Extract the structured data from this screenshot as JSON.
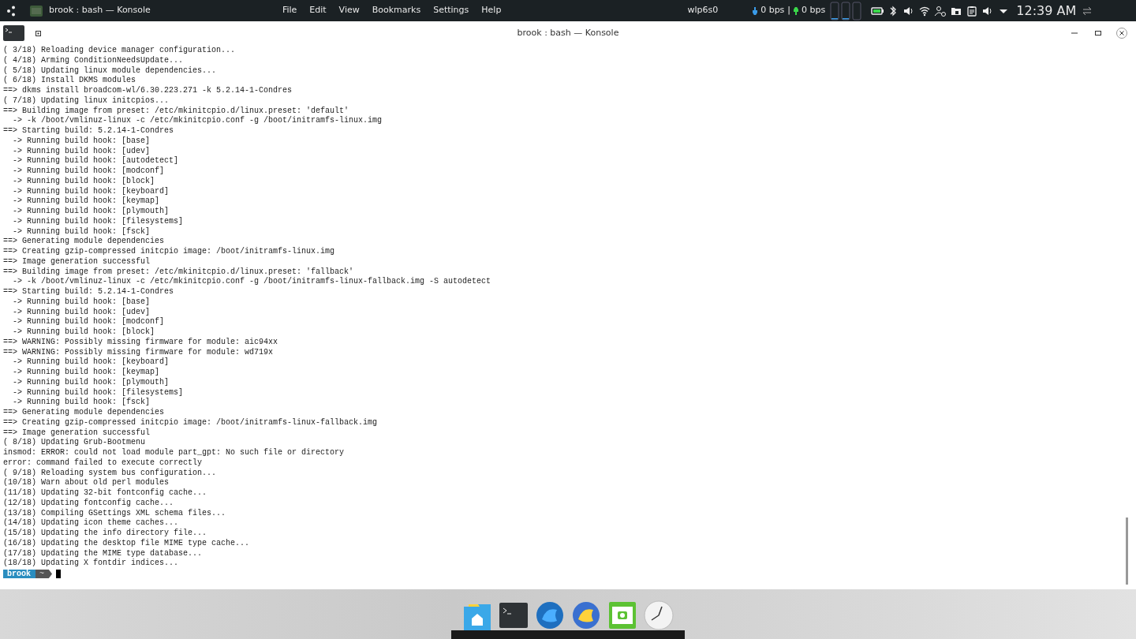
{
  "top_panel": {
    "window_title": "brook : bash — Konsole",
    "menu": [
      "File",
      "Edit",
      "View",
      "Bookmarks",
      "Settings",
      "Help"
    ],
    "network_interface": "wlp6s0",
    "download_rate": "0 bps",
    "separator": "|",
    "upload_rate": "0 bps",
    "clock": "12:39 AM"
  },
  "window": {
    "title": "brook : bash — Konsole"
  },
  "terminal": {
    "lines": [
      "( 3/18) Reloading device manager configuration...",
      "( 4/18) Arming ConditionNeedsUpdate...",
      "( 5/18) Updating linux module dependencies...",
      "( 6/18) Install DKMS modules",
      "==> dkms install broadcom-wl/6.30.223.271 -k 5.2.14-1-Condres",
      "( 7/18) Updating linux initcpios...",
      "==> Building image from preset: /etc/mkinitcpio.d/linux.preset: 'default'",
      "  -> -k /boot/vmlinuz-linux -c /etc/mkinitcpio.conf -g /boot/initramfs-linux.img",
      "==> Starting build: 5.2.14-1-Condres",
      "  -> Running build hook: [base]",
      "  -> Running build hook: [udev]",
      "  -> Running build hook: [autodetect]",
      "  -> Running build hook: [modconf]",
      "  -> Running build hook: [block]",
      "  -> Running build hook: [keyboard]",
      "  -> Running build hook: [keymap]",
      "  -> Running build hook: [plymouth]",
      "  -> Running build hook: [filesystems]",
      "  -> Running build hook: [fsck]",
      "==> Generating module dependencies",
      "==> Creating gzip-compressed initcpio image: /boot/initramfs-linux.img",
      "==> Image generation successful",
      "==> Building image from preset: /etc/mkinitcpio.d/linux.preset: 'fallback'",
      "  -> -k /boot/vmlinuz-linux -c /etc/mkinitcpio.conf -g /boot/initramfs-linux-fallback.img -S autodetect",
      "==> Starting build: 5.2.14-1-Condres",
      "  -> Running build hook: [base]",
      "  -> Running build hook: [udev]",
      "  -> Running build hook: [modconf]",
      "  -> Running build hook: [block]",
      "==> WARNING: Possibly missing firmware for module: aic94xx",
      "==> WARNING: Possibly missing firmware for module: wd719x",
      "  -> Running build hook: [keyboard]",
      "  -> Running build hook: [keymap]",
      "  -> Running build hook: [plymouth]",
      "  -> Running build hook: [filesystems]",
      "  -> Running build hook: [fsck]",
      "==> Generating module dependencies",
      "==> Creating gzip-compressed initcpio image: /boot/initramfs-linux-fallback.img",
      "==> Image generation successful",
      "( 8/18) Updating Grub-Bootmenu",
      "insmod: ERROR: could not load module part_gpt: No such file or directory",
      "error: command failed to execute correctly",
      "( 9/18) Reloading system bus configuration...",
      "(10/18) Warn about old perl modules",
      "(11/18) Updating 32-bit fontconfig cache...",
      "(12/18) Updating fontconfig cache...",
      "(13/18) Compiling GSettings XML schema files...",
      "(14/18) Updating icon theme caches...",
      "(15/18) Updating the info directory file...",
      "(16/18) Updating the desktop file MIME type cache...",
      "(17/18) Updating the MIME type database...",
      "(18/18) Updating X fontdir indices..."
    ],
    "prompt": {
      "user": "brook",
      "directory": "~"
    }
  }
}
